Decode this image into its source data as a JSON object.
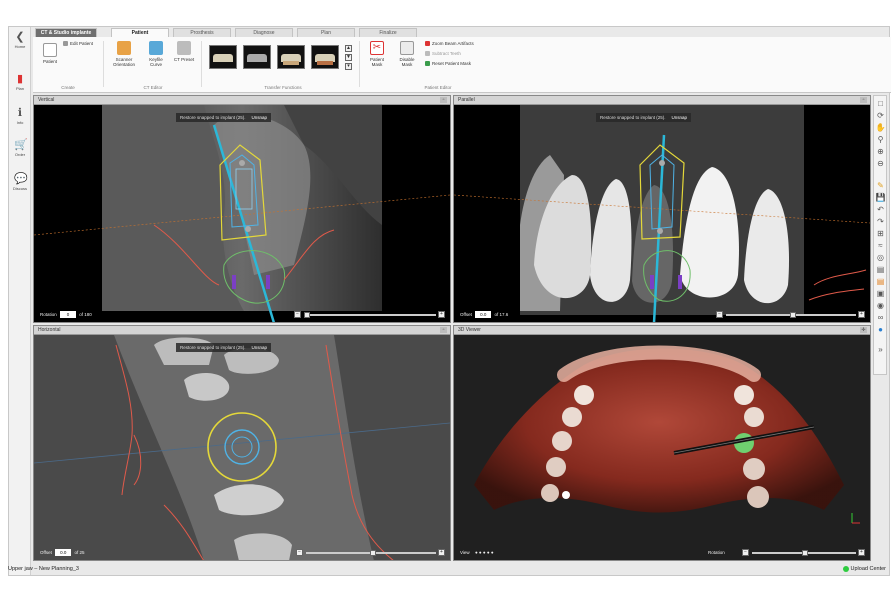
{
  "app": {
    "title": "CT & Studio implante"
  },
  "tabs": [
    "Patient",
    "Prosthesis",
    "Diagnose",
    "Plan",
    "Finalize"
  ],
  "leftnav": [
    {
      "label": "Home",
      "icon": "back-arrow-icon"
    },
    {
      "label": "Plan",
      "icon": "plan-icon"
    },
    {
      "label": "Info",
      "icon": "info-icon"
    },
    {
      "label": "Order",
      "icon": "cart-icon"
    },
    {
      "label": "Discuss",
      "icon": "chat-icon"
    }
  ],
  "ribbon": {
    "patient_label": "Patient",
    "edit_patient": "Edit Patient",
    "group_create": "Create",
    "scanner_orientation": "Scanner Orientation",
    "keyfile_curve": "Keyfile Curve",
    "ct_preset": "CT Preset",
    "group_ct_editor": "CT Editor",
    "group_transfer": "Transfer Functions",
    "patient_mask": "Patient Mask",
    "disable_mask": "Disable Mask",
    "zoom_beam": "Zoom Beam Artifacts",
    "subtract_teeth": "Subtract Teeth",
    "reset_mask": "Reset Patient Mask",
    "group_patient_editor": "Patient Editor"
  },
  "viewports": {
    "vertical": {
      "title": "Vertical",
      "notice": "Restore snapped to implant (25).",
      "notice_action": "Unsnap",
      "slider_label": "Rotation",
      "slider_value": "0",
      "slider_suffix": "of 180"
    },
    "parallel": {
      "title": "Parallel",
      "notice": "Restore snapped to implant (25).",
      "notice_action": "Unsnap",
      "slider_label": "Offset",
      "slider_value": "0.0",
      "slider_suffix": "of 17.6"
    },
    "horizontal": {
      "title": "Horizontal",
      "notice": "Restore snapped to implant (25).",
      "notice_action": "Unsnap",
      "slider_label": "Offset",
      "slider_value": "0.0",
      "slider_suffix": "of 25"
    },
    "viewer3d": {
      "title": "3D Viewer",
      "slider_label": "Rotation",
      "view_label": "View"
    }
  },
  "statusbar": {
    "left": "Upper jaw – New Planning_3",
    "right": "Upload Center"
  },
  "colors": {
    "implant": "#4fb3e6",
    "nerve": "#e05a4a",
    "guide": "#e4d83a",
    "axis": "#2bb8d8"
  }
}
